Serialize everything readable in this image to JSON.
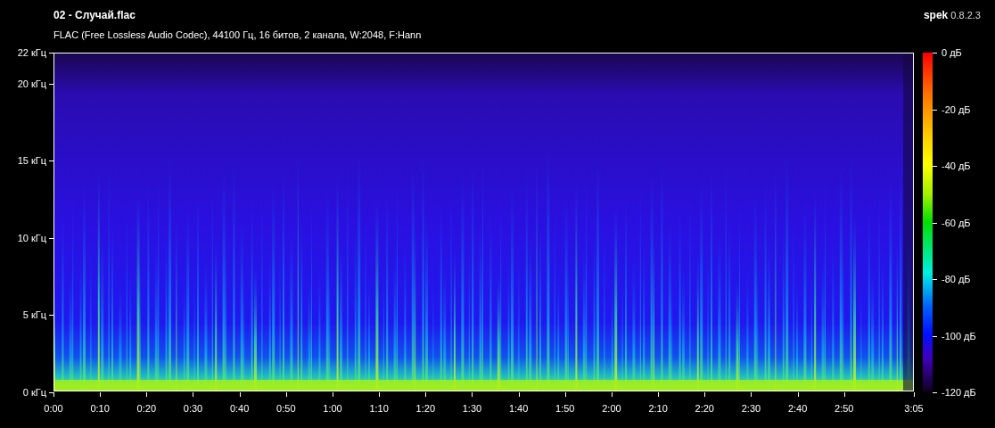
{
  "window": {
    "title": "02 - Случай.flac",
    "brand": "**spek** 0.8.2.3"
  },
  "info": "FLAC (Free Lossless Audio Codec), 44100 Гц, 16 битов, 2 канала, W:2048, F:Hann",
  "frequency_axis": [
    "22 кГц",
    "20 кГц",
    "15 кГц",
    "10 кГц",
    "5 кГц",
    "0 кГц"
  ],
  "time_axis": [
    "0:00",
    "0:10",
    "0:20",
    "0:30",
    "0:40",
    "0:50",
    "1:00",
    "1:10",
    "1:20",
    "1:30",
    "1:40",
    "1:50",
    "2:00",
    "2:10",
    "2:20",
    "2:30",
    "2:40",
    "2:50",
    "3:05"
  ],
  "level_scale": [
    "0 дБ",
    "-20 дБ",
    "-40 дБ",
    "-60 дБ",
    "-80 дБ",
    "-100 дБ",
    "-120 дБ"
  ]
}
